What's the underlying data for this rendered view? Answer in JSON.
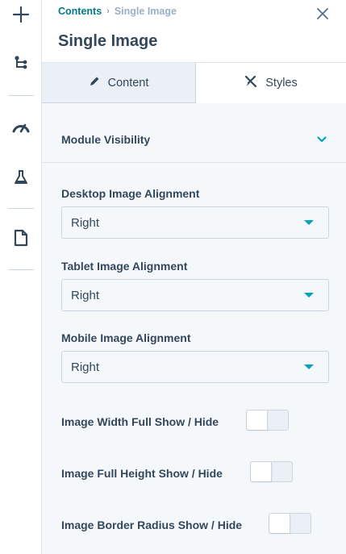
{
  "rail": {
    "icons": [
      "plus-icon",
      "tree-icon",
      "gauge-icon",
      "flask-icon",
      "document-icon"
    ]
  },
  "header": {
    "breadcrumb": {
      "parent": "Contents",
      "separator": "›",
      "current": "Single Image"
    },
    "title": "Single Image",
    "close_icon": "close-icon"
  },
  "tabs": [
    {
      "label": "Content",
      "icon": "pencil-icon",
      "active": false
    },
    {
      "label": "Styles",
      "icon": "paint-tools-icon",
      "active": true
    }
  ],
  "module_visibility": {
    "label": "Module Visibility",
    "icon": "chevron-down-icon",
    "expanded": false
  },
  "fields": [
    {
      "label": "Desktop Image Alignment",
      "value": "Right"
    },
    {
      "label": "Tablet Image Alignment",
      "value": "Right"
    },
    {
      "label": "Mobile Image Alignment",
      "value": "Right"
    }
  ],
  "toggles": [
    {
      "label": "Image Width Full Show / Hide",
      "on": false
    },
    {
      "label": "Image Full Height Show / Hide",
      "on": false
    },
    {
      "label": "Image Border Radius Show / Hide",
      "on": false
    }
  ],
  "colors": {
    "accent": "#00a4bd",
    "link": "#007a8c",
    "text": "#33475b",
    "panel_bg": "#f5f8fa",
    "tab_inactive_bg": "#eaf0f6",
    "border": "#cbd6e2"
  }
}
